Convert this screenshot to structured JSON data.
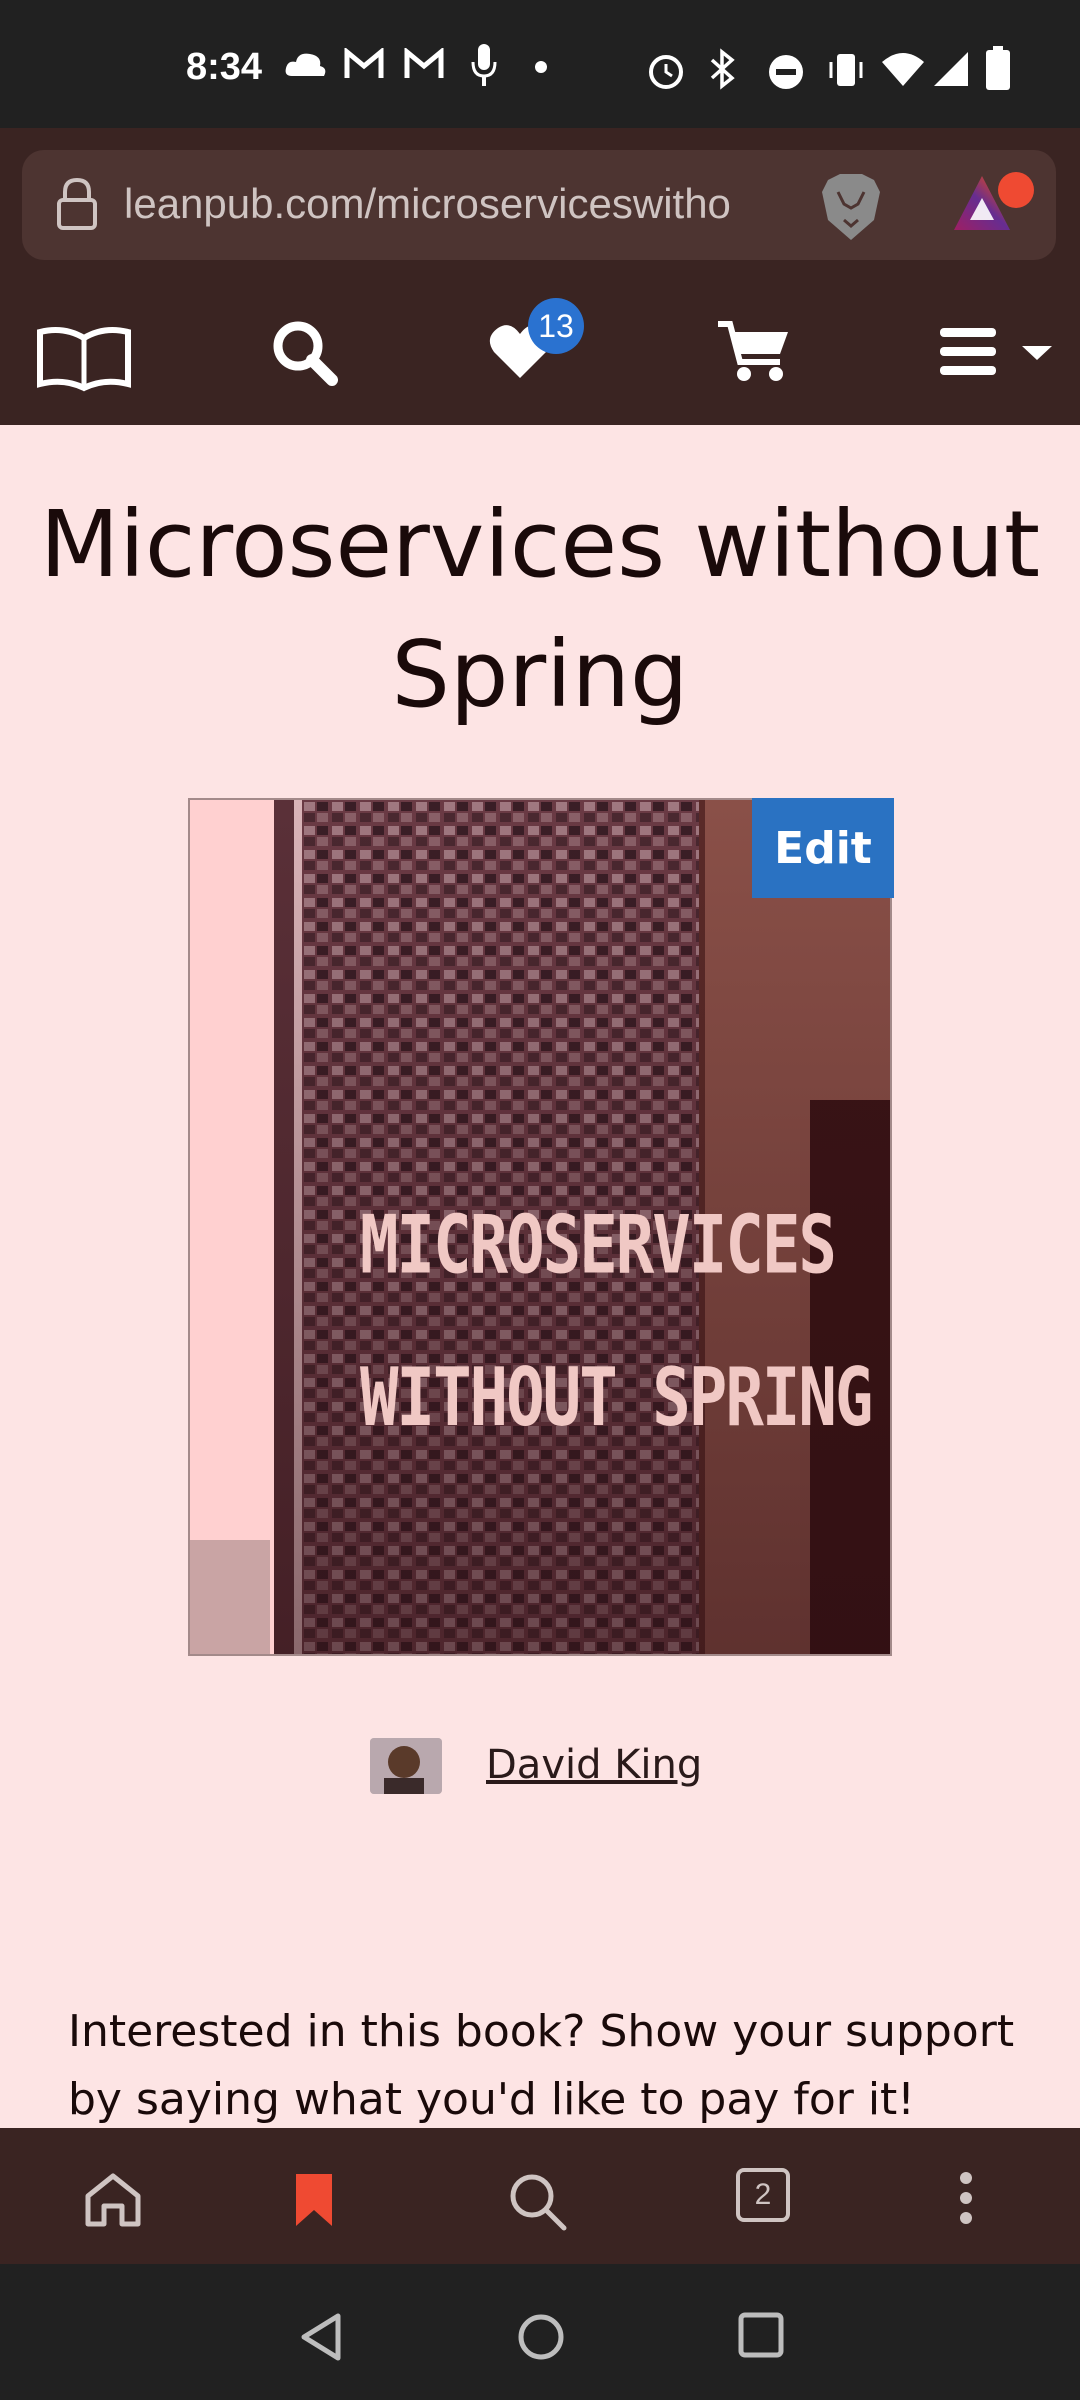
{
  "status_bar": {
    "time": "8:34",
    "icons": [
      "cloud-icon",
      "gmail-icon",
      "gmail-icon",
      "mic-icon",
      "dot-icon",
      "alarm-icon",
      "bluetooth-icon",
      "dnd-icon",
      "vibrate-icon",
      "wifi-icon",
      "signal-icon",
      "battery-icon"
    ]
  },
  "browser": {
    "url": "leanpub.com/microserviceswitho",
    "icons": [
      "lock-icon",
      "brave-lion-icon",
      "brave-rewards-icon"
    ]
  },
  "site_nav": {
    "items": [
      "book-icon",
      "search-icon",
      "heart-icon",
      "cart-icon",
      "menu-icon"
    ],
    "wishlist_count": "13"
  },
  "book": {
    "title": "Microservices without Spring",
    "edit_label": "Edit",
    "cover_title_line1": "MICROSERVICES",
    "cover_title_line2": "WITHOUT SPRING"
  },
  "author": {
    "name": "David King"
  },
  "pitch": "Interested in this book? Show your support by saying what you'd like to pay for it!",
  "bottom_nav": {
    "items": [
      "home-icon",
      "bookmark-icon",
      "search-icon",
      "tabs-icon",
      "more-icon"
    ],
    "tab_count": "2"
  },
  "colors": {
    "page_bg": "#fde4e4",
    "nav_bg": "#3a2422",
    "accent_blue": "#2a72c2",
    "bookmark_red": "#ef4a32"
  }
}
